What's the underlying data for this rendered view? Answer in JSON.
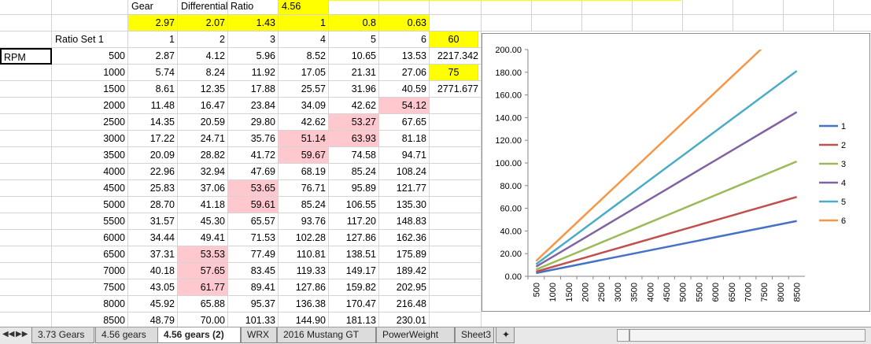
{
  "header": {
    "gear_label": "Gear",
    "diff_label": "Differential Ratio",
    "diff_value": "4.56",
    "ratios": [
      "2.97",
      "2.07",
      "1.43",
      "1",
      "0.8",
      "0.63"
    ],
    "ratio_set_label": "Ratio Set 1",
    "gear_numbers": [
      "1",
      "2",
      "3",
      "4",
      "5",
      "6"
    ],
    "h_value": "60",
    "rpm_label": "RPM"
  },
  "side": {
    "r500": "2217.342",
    "r1000": "75",
    "r1500": "2771.677"
  },
  "rows": [
    {
      "rpm": "500",
      "vals": [
        "2.87",
        "4.12",
        "5.96",
        "8.52",
        "10.65",
        "13.53"
      ]
    },
    {
      "rpm": "1000",
      "vals": [
        "5.74",
        "8.24",
        "11.92",
        "17.05",
        "21.31",
        "27.06"
      ]
    },
    {
      "rpm": "1500",
      "vals": [
        "8.61",
        "12.35",
        "17.88",
        "25.57",
        "31.96",
        "40.59"
      ]
    },
    {
      "rpm": "2000",
      "vals": [
        "11.48",
        "16.47",
        "23.84",
        "34.09",
        "42.62",
        "54.12"
      ]
    },
    {
      "rpm": "2500",
      "vals": [
        "14.35",
        "20.59",
        "29.80",
        "42.62",
        "53.27",
        "67.65"
      ]
    },
    {
      "rpm": "3000",
      "vals": [
        "17.22",
        "24.71",
        "35.76",
        "51.14",
        "63.93",
        "81.18"
      ]
    },
    {
      "rpm": "3500",
      "vals": [
        "20.09",
        "28.82",
        "41.72",
        "59.67",
        "74.58",
        "94.71"
      ]
    },
    {
      "rpm": "4000",
      "vals": [
        "22.96",
        "32.94",
        "47.69",
        "68.19",
        "85.24",
        "108.24"
      ]
    },
    {
      "rpm": "4500",
      "vals": [
        "25.83",
        "37.06",
        "53.65",
        "76.71",
        "95.89",
        "121.77"
      ]
    },
    {
      "rpm": "5000",
      "vals": [
        "28.70",
        "41.18",
        "59.61",
        "85.24",
        "106.55",
        "135.30"
      ]
    },
    {
      "rpm": "5500",
      "vals": [
        "31.57",
        "45.30",
        "65.57",
        "93.76",
        "117.20",
        "148.83"
      ]
    },
    {
      "rpm": "6000",
      "vals": [
        "34.44",
        "49.41",
        "71.53",
        "102.28",
        "127.86",
        "162.36"
      ]
    },
    {
      "rpm": "6500",
      "vals": [
        "37.31",
        "53.53",
        "77.49",
        "110.81",
        "138.51",
        "175.89"
      ]
    },
    {
      "rpm": "7000",
      "vals": [
        "40.18",
        "57.65",
        "83.45",
        "119.33",
        "149.17",
        "189.42"
      ]
    },
    {
      "rpm": "7500",
      "vals": [
        "43.05",
        "61.77",
        "89.41",
        "127.86",
        "159.82",
        "202.95"
      ]
    },
    {
      "rpm": "8000",
      "vals": [
        "45.92",
        "65.88",
        "95.37",
        "136.38",
        "170.47",
        "216.48"
      ]
    },
    {
      "rpm": "8500",
      "vals": [
        "48.79",
        "70.00",
        "101.33",
        "144.90",
        "181.13",
        "230.01"
      ]
    }
  ],
  "highlights": {
    "pink": [
      [
        3,
        5
      ],
      [
        4,
        4
      ],
      [
        5,
        3
      ],
      [
        5,
        4
      ],
      [
        6,
        3
      ],
      [
        8,
        2
      ],
      [
        9,
        2
      ],
      [
        12,
        1
      ],
      [
        13,
        1
      ],
      [
        14,
        1
      ]
    ]
  },
  "tabs": [
    "3.73 Gears",
    "4.56 gears",
    "4.56 gears (2)",
    "WRX",
    "2016 Mustang GT",
    "PowerWeight",
    "Sheet3"
  ],
  "active_tab": 2,
  "colors": {
    "yellow": "#ffff00",
    "pink": "#ffc7ce",
    "series": [
      "#4472c4",
      "#c0504d",
      "#9bbb59",
      "#8064a2",
      "#4bacc6",
      "#f79646"
    ]
  },
  "chart_data": {
    "type": "line",
    "x": [
      500,
      1000,
      1500,
      2000,
      2500,
      3000,
      3500,
      4000,
      4500,
      5000,
      5500,
      6000,
      6500,
      7000,
      7500,
      8000,
      8500
    ],
    "ylim": [
      0,
      200
    ],
    "yticks": [
      "0.00",
      "20.00",
      "40.00",
      "60.00",
      "80.00",
      "100.00",
      "120.00",
      "140.00",
      "160.00",
      "180.00",
      "200.00"
    ],
    "legend_position": "right",
    "grid": false,
    "series": [
      {
        "name": "1",
        "values": [
          2.87,
          5.74,
          8.61,
          11.48,
          14.35,
          17.22,
          20.09,
          22.96,
          25.83,
          28.7,
          31.57,
          34.44,
          37.31,
          40.18,
          43.05,
          45.92,
          48.79
        ]
      },
      {
        "name": "2",
        "values": [
          4.12,
          8.24,
          12.35,
          16.47,
          20.59,
          24.71,
          28.82,
          32.94,
          37.06,
          41.18,
          45.3,
          49.41,
          53.53,
          57.65,
          61.77,
          65.88,
          70.0
        ]
      },
      {
        "name": "3",
        "values": [
          5.96,
          11.92,
          17.88,
          23.84,
          29.8,
          35.76,
          41.72,
          47.69,
          53.65,
          59.61,
          65.57,
          71.53,
          77.49,
          83.45,
          89.41,
          95.37,
          101.33
        ]
      },
      {
        "name": "4",
        "values": [
          8.52,
          17.05,
          25.57,
          34.09,
          42.62,
          51.14,
          59.67,
          68.19,
          76.71,
          85.24,
          93.76,
          102.28,
          110.81,
          119.33,
          127.86,
          136.38,
          144.9
        ]
      },
      {
        "name": "5",
        "values": [
          10.65,
          21.31,
          31.96,
          42.62,
          53.27,
          63.93,
          74.58,
          85.24,
          95.89,
          106.55,
          117.2,
          127.86,
          138.51,
          149.17,
          159.82,
          170.47,
          181.13
        ]
      },
      {
        "name": "6",
        "values": [
          13.53,
          27.06,
          40.59,
          54.12,
          67.65,
          81.18,
          94.71,
          108.24,
          121.77,
          135.3,
          148.83,
          162.36,
          175.89,
          189.42,
          202.95,
          216.48,
          230.01
        ]
      }
    ]
  }
}
